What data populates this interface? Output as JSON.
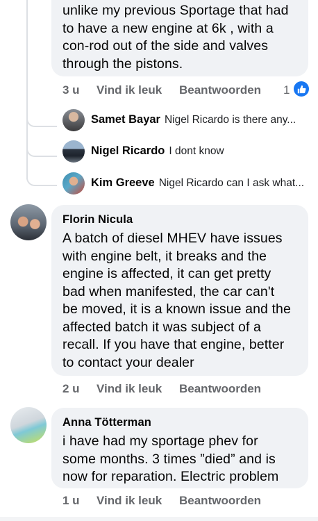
{
  "comments": [
    {
      "text": "unlike my previous Sportage that had\nto have a new engine at 6k , with a\ncon-rod out of the side and valves\nthrough the pistons.",
      "time": "3 u",
      "like_label": "Vind ik leuk",
      "reply_label": "Beantwoorden",
      "like_count": "1"
    },
    {
      "author": "Florin Nicula",
      "text": "A batch of diesel MHEV have issues\nwith engine belt, it breaks and the\nengine is affected, it can get pretty\nbad when manifested, the car can't\nbe moved, it is a known issue and the\naffected batch it was subject of a\nrecall. If you have that engine, better\nto contact your dealer",
      "time": "2 u",
      "like_label": "Vind ik leuk",
      "reply_label": "Beantwoorden"
    },
    {
      "author": "Anna Tötterman",
      "text": "i have had my sportage phev for\nsome months. 3 times ”died” and is\nnow for reparation. Electric problem",
      "time": "1 u",
      "like_label": "Vind ik leuk",
      "reply_label": "Beantwoorden"
    }
  ],
  "replies": [
    {
      "author": "Samet Bayar",
      "preview": "Nigel Ricardo is there any..."
    },
    {
      "author": "Nigel Ricardo",
      "preview": "I dont know"
    },
    {
      "author": "Kim Greeve",
      "preview": "Nigel Ricardo can I ask what..."
    }
  ],
  "colors": {
    "bubble_bg": "#f0f2f5",
    "meta_text": "#65676b",
    "like_blue": "#1877f2"
  },
  "icons": [
    "like-thumb-icon"
  ]
}
